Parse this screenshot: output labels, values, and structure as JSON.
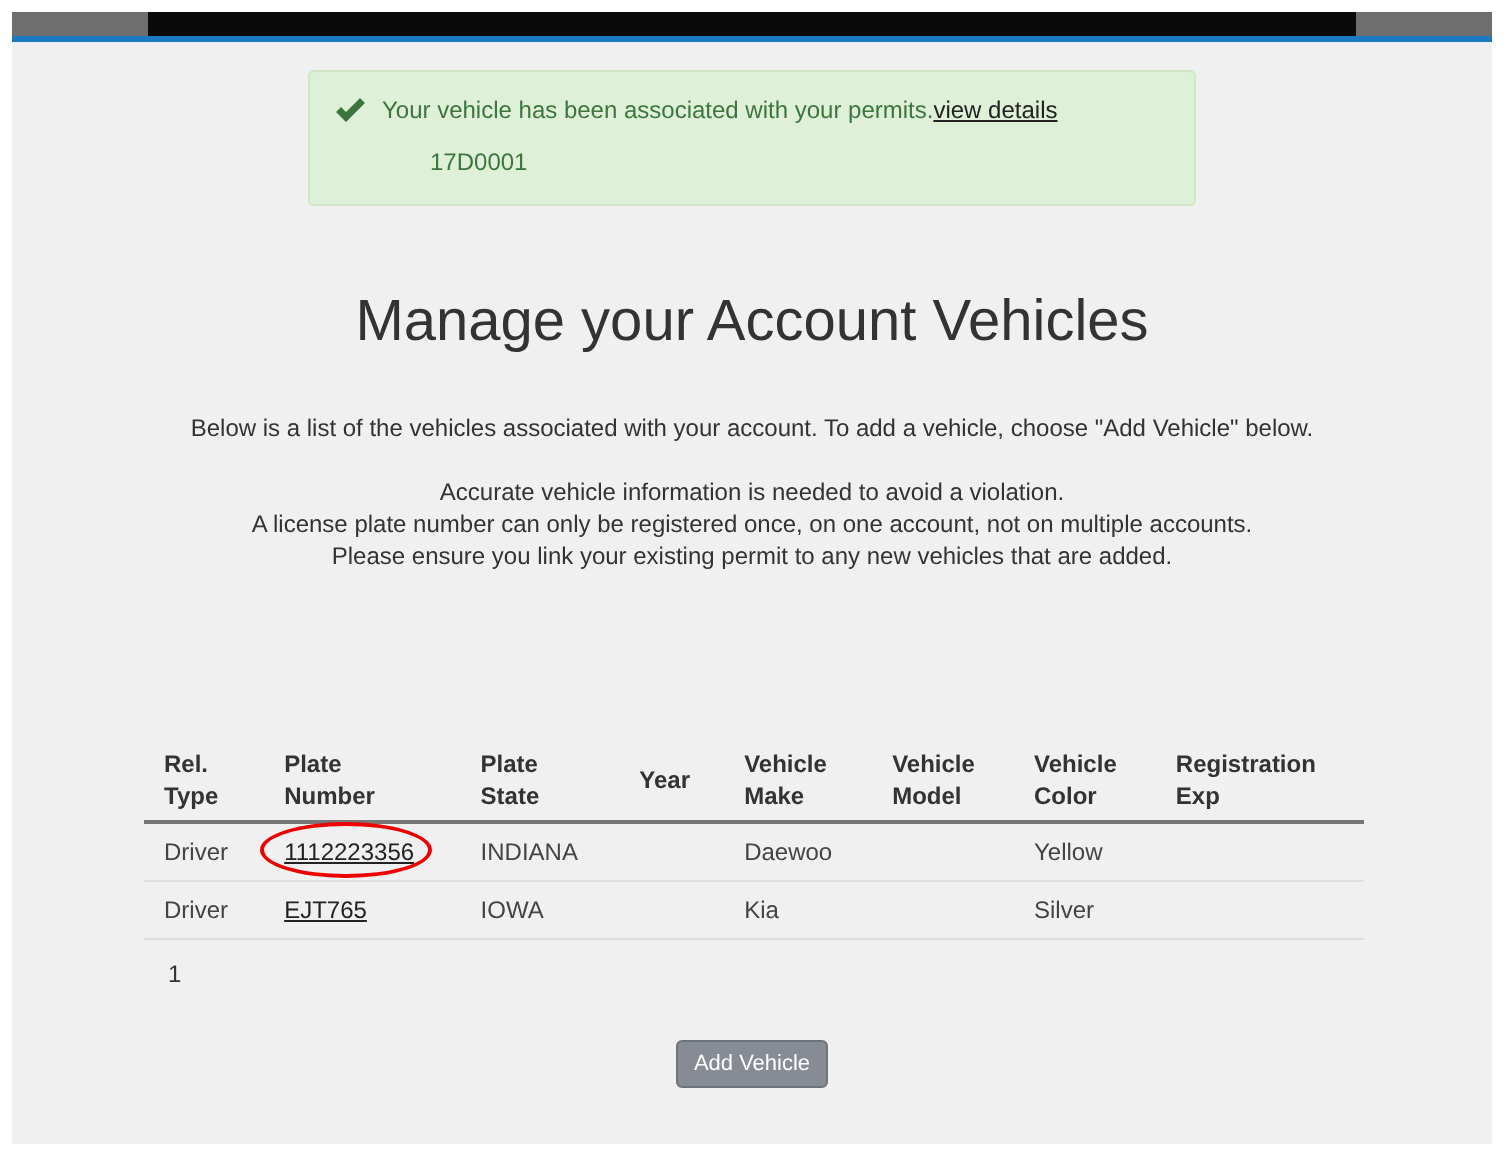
{
  "alert": {
    "message": "Your vehicle has been associated with your permits.",
    "link": "view details",
    "permit": "17D0001"
  },
  "title": "Manage your Account Vehicles",
  "intro": "Below is a list of the vehicles associated with your account. To add a vehicle, choose \"Add Vehicle\" below.",
  "notes": [
    "Accurate vehicle information is needed to avoid a violation.",
    "A license plate number can only be registered once, on one account, not on multiple accounts.",
    "Please ensure you link your existing permit to any new vehicles that are added."
  ],
  "table": {
    "columns": [
      "Rel. Type",
      "Plate Number",
      "Plate State",
      "Year",
      "Vehicle Make",
      "Vehicle Model",
      "Vehicle Color",
      "Registration Exp"
    ],
    "rows": [
      {
        "circled": true,
        "cells": [
          "Driver",
          "1112223356",
          "INDIANA",
          "",
          "Daewoo",
          "",
          "Yellow",
          ""
        ]
      },
      {
        "circled": false,
        "cells": [
          "Driver",
          "EJT765",
          "IOWA",
          "",
          "Kia",
          "",
          "Silver",
          ""
        ]
      }
    ]
  },
  "pagination": "1",
  "button": "Add Vehicle"
}
